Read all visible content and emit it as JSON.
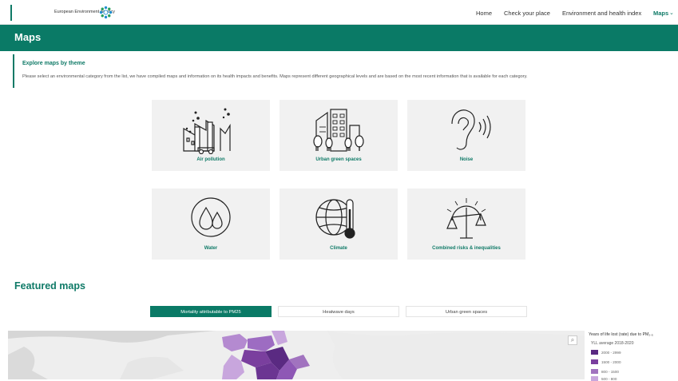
{
  "header": {
    "agency_name": "European Environment Agency",
    "logo_icon": "eea-flower-logo",
    "nav": [
      {
        "label": "Home"
      },
      {
        "label": "Check your place"
      },
      {
        "label": "Environment and health index"
      },
      {
        "label": "Maps",
        "active": true
      }
    ]
  },
  "banner": {
    "title": "Maps"
  },
  "intro": {
    "title": "Explore maps by theme",
    "description": "Please select an environmental category from the list, we have compiled maps and information on its health impacts and benefits. Maps represent different geographical levels and are based on the most recent information that is available for each category."
  },
  "themes": [
    {
      "label": "Air pollution",
      "icon": "factory-pollution-icon"
    },
    {
      "label": "Urban green spaces",
      "icon": "city-trees-icon"
    },
    {
      "label": "Noise",
      "icon": "ear-sound-icon"
    },
    {
      "label": "Water",
      "icon": "water-drops-icon"
    },
    {
      "label": "Climate",
      "icon": "globe-thermometer-icon"
    },
    {
      "label": "Combined risks & inequalities",
      "icon": "balance-scale-icon"
    }
  ],
  "featured": {
    "title": "Featured maps",
    "tabs": [
      {
        "label": "Mortality attributable to PM25",
        "active": true
      },
      {
        "label": "Heatwave days",
        "active": false
      },
      {
        "label": "Urban green spaces",
        "active": false
      }
    ]
  },
  "legend": {
    "title": "Years of life lost (rate) due to PM₂.₅",
    "subtitle": "YLL average 2018-2020",
    "items": [
      {
        "label": "2000 - 2999",
        "color": "#5a2a82"
      },
      {
        "label": "1500 - 2000",
        "color": "#7a3f9e"
      },
      {
        "label": "800 - 1500",
        "color": "#a173bf"
      },
      {
        "label": "500 - 800",
        "color": "#c8a6dd"
      }
    ]
  },
  "colors": {
    "accent": "#0a7a66",
    "card_bg": "#f1f1f1"
  }
}
